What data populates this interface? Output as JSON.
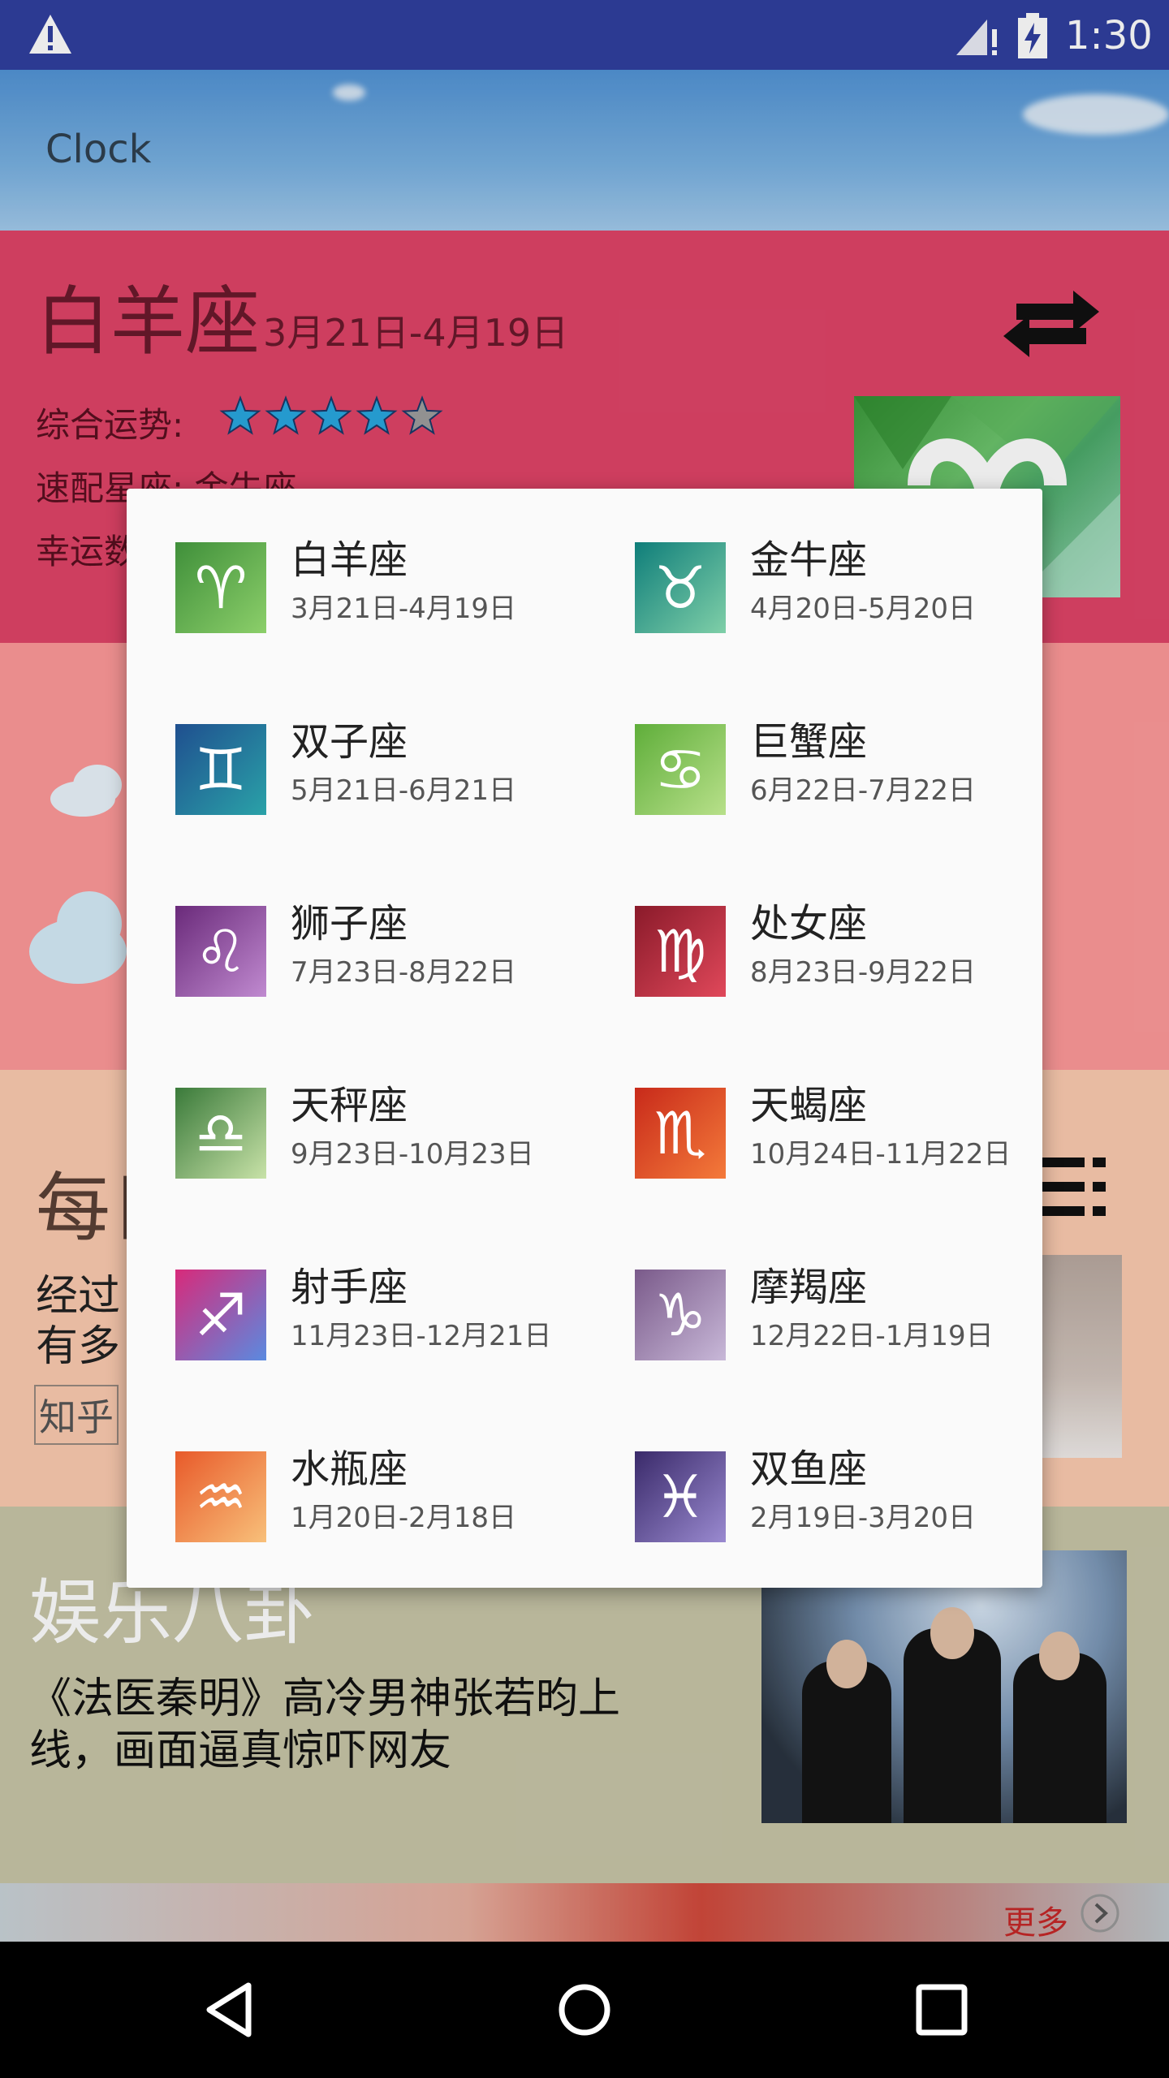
{
  "status_bar": {
    "time": "1:30"
  },
  "app_bar": {
    "title": "Clock"
  },
  "zodiac_card": {
    "name": "白羊座",
    "date_range": "3月21日-4月19日",
    "overall_label": "综合运势:",
    "overall_rating": 4,
    "overall_max": 5,
    "match_label": "速配星座: 金牛座",
    "lucky_label": "幸运数"
  },
  "daily_card": {
    "title": "每日",
    "line1": "经过",
    "line2": "有多",
    "source_tag": "知乎"
  },
  "entertainment_card": {
    "title": "娱乐八卦",
    "headline_line1": "《法医秦明》高冷男神张若昀上",
    "headline_line2": "线，画面逼真惊吓网友"
  },
  "bottom_strip": {
    "more_label": "更多"
  },
  "zodiac_dialog": {
    "items": [
      {
        "name": "白羊座",
        "dates": "3月21日-4月19日",
        "symbol": "♈",
        "icon": "aries-icon",
        "colors": [
          "#3f8f3a",
          "#8ccf6a"
        ]
      },
      {
        "name": "金牛座",
        "dates": "4月20日-5月20日",
        "symbol": "♉",
        "icon": "taurus-icon",
        "colors": [
          "#0f7e7a",
          "#7fcfa8"
        ]
      },
      {
        "name": "双子座",
        "dates": "5月21日-6月21日",
        "symbol": "♊",
        "icon": "gemini-icon",
        "colors": [
          "#1f4f8f",
          "#2aa2a8"
        ]
      },
      {
        "name": "巨蟹座",
        "dates": "6月22日-7月22日",
        "symbol": "♋",
        "icon": "cancer-icon",
        "colors": [
          "#5fae3a",
          "#b8e08a"
        ]
      },
      {
        "name": "狮子座",
        "dates": "7月23日-8月22日",
        "symbol": "♌",
        "icon": "leo-icon",
        "colors": [
          "#6a2a7a",
          "#c08ad0"
        ]
      },
      {
        "name": "处女座",
        "dates": "8月23日-9月22日",
        "symbol": "♍",
        "icon": "virgo-icon",
        "colors": [
          "#8a1a2a",
          "#e0485a"
        ]
      },
      {
        "name": "天秤座",
        "dates": "9月23日-10月23日",
        "symbol": "♎",
        "icon": "libra-icon",
        "colors": [
          "#3a7a3a",
          "#c8e2a8"
        ]
      },
      {
        "name": "天蝎座",
        "dates": "10月24日-11月22日",
        "symbol": "♏",
        "icon": "scorpio-icon",
        "colors": [
          "#c82a1a",
          "#f47a3a"
        ]
      },
      {
        "name": "射手座",
        "dates": "11月23日-12月21日",
        "symbol": "♐",
        "icon": "sagittarius-icon",
        "colors": [
          "#d82a7a",
          "#5a8ae0"
        ]
      },
      {
        "name": "摩羯座",
        "dates": "12月22日-1月19日",
        "symbol": "♑",
        "icon": "capricorn-icon",
        "colors": [
          "#7a5a8a",
          "#c8b8d8"
        ]
      },
      {
        "name": "水瓶座",
        "dates": "1月20日-2月18日",
        "symbol": "♒",
        "icon": "aquarius-icon",
        "colors": [
          "#e85a2a",
          "#f8c07a"
        ]
      },
      {
        "name": "双鱼座",
        "dates": "2月19日-3月20日",
        "symbol": "♓",
        "icon": "pisces-icon",
        "colors": [
          "#3a2a6a",
          "#9a8ad0"
        ]
      }
    ]
  }
}
